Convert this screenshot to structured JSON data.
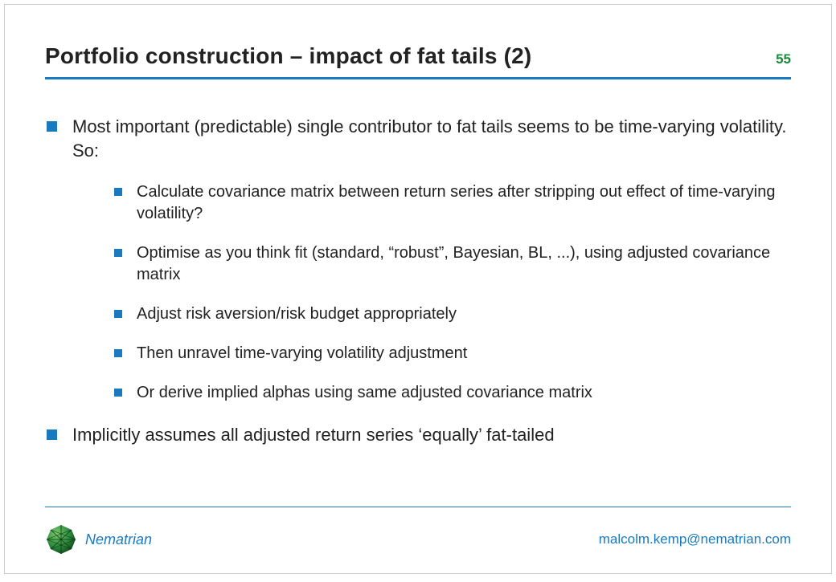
{
  "page_number": "55",
  "title": "Portfolio construction – impact of fat tails (2)",
  "bullets": {
    "b0": "Most important (predictable) single contributor to fat tails seems to be time-varying volatility. So:",
    "b0_sub": {
      "s0": "Calculate covariance matrix between return series after stripping out effect of time-varying volatility?",
      "s1": "Optimise as you think fit (standard, “robust”, Bayesian, BL, ...), using adjusted covariance matrix",
      "s2": "Adjust risk aversion/risk budget appropriately",
      "s3": "Then unravel time-varying volatility adjustment",
      "s4": "Or derive implied alphas using same adjusted covariance matrix"
    },
    "b1": "Implicitly assumes all adjusted return series ‘equally’ fat-tailed"
  },
  "footer": {
    "brand": "Nematrian",
    "contact": "malcolm.kemp@nematrian.com"
  },
  "colors": {
    "accent_blue": "#1a7abf",
    "accent_green": "#1a8a3a"
  }
}
